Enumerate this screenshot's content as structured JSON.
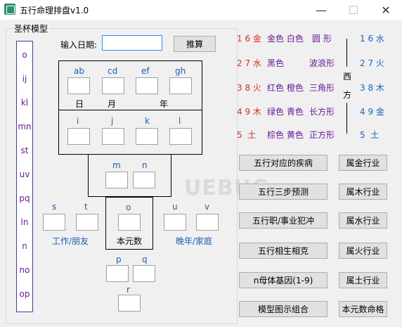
{
  "window": {
    "title": "五行命理排盘v1.0",
    "min_glyph": "—",
    "max_glyph": "☐",
    "close_glyph": "✕"
  },
  "groupbox_label": "圣杯模型",
  "left_list": [
    "o",
    "ij",
    "kl",
    "mn",
    "st",
    "uv",
    "pq",
    "ln",
    "n",
    "no",
    "op"
  ],
  "date_label": "输入日期:",
  "date_value": "",
  "calc_button": "推算",
  "top_frame": {
    "col_labels": [
      "ab",
      "cd",
      "ef",
      "gh"
    ],
    "row_labels": [
      "日",
      "月",
      "年"
    ],
    "col_labels2": [
      "i",
      "j",
      "k",
      "l"
    ]
  },
  "mid_frame": {
    "labels": [
      "m",
      "n"
    ]
  },
  "lower": {
    "s": "s",
    "t": "t",
    "o": "o",
    "u": "u",
    "v": "v",
    "work_friends": "工作/朋友",
    "self_number": "本元数",
    "late_family": "晚年/家庭",
    "p": "p",
    "q": "q",
    "r": "r"
  },
  "elements_left": [
    {
      "num": "1 6 金",
      "colors": "金色 白色",
      "shape": "圆 形"
    },
    {
      "num": "2 7 水",
      "colors": "黑色",
      "shape": "波浪形"
    },
    {
      "num": "3 8 火",
      "colors": "红色 橙色",
      "shape": "三角形"
    },
    {
      "num": "4 9 木",
      "colors": "绿色 青色",
      "shape": "长方形"
    },
    {
      "num": "5  土",
      "colors": "棕色 黄色",
      "shape": "正方形"
    }
  ],
  "west_label": [
    "西",
    "方"
  ],
  "elements_right": [
    "1 6 水",
    "2 7 火",
    "3 8 木",
    "4 9 金",
    "5  土"
  ],
  "action_buttons": [
    "五行对应的疾病",
    "五行三步预测",
    "五行职/事业犯冲",
    "五行相生相克",
    "n母体基因(1-9)",
    "模型图示组合"
  ],
  "industry_buttons": [
    "属金行业",
    "属木行业",
    "属水行业",
    "属火行业",
    "属土行业",
    "本元数命格"
  ],
  "watermark": "UEBUG"
}
